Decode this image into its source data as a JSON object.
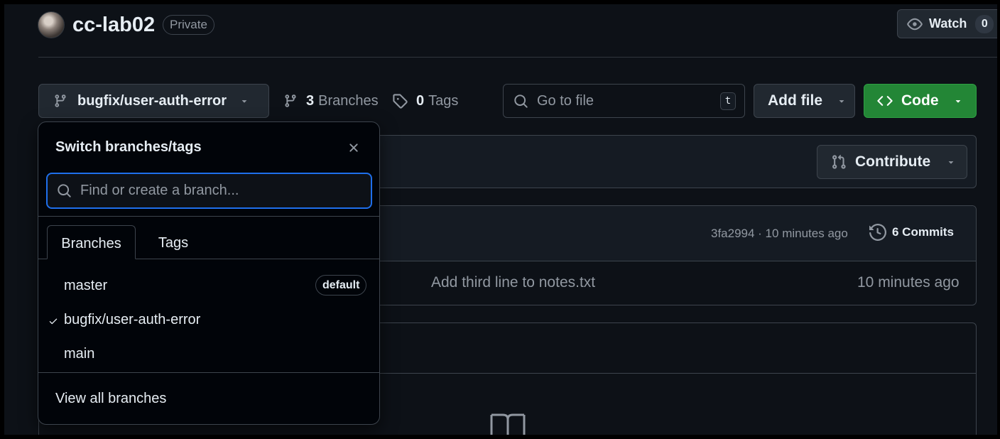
{
  "repo": {
    "name": "cc-lab02",
    "visibility": "Private",
    "watch_label": "Watch",
    "watch_count": "0"
  },
  "toolbar": {
    "current_branch": "bugfix/user-auth-error",
    "branches_count": "3",
    "branches_label": "Branches",
    "tags_count": "0",
    "tags_label": "Tags",
    "goto_placeholder": "Go to file",
    "goto_shortcut": "t",
    "add_file_label": "Add file",
    "code_label": "Code"
  },
  "contribute": {
    "label": "Contribute"
  },
  "latest_commit": {
    "meta": "3fa2994 · 10 minutes ago",
    "commits_label": "6 Commits"
  },
  "file_row": {
    "message": "Add third line to notes.txt",
    "time": "10 minutes ago"
  },
  "branch_dropdown": {
    "title": "Switch branches/tags",
    "search_placeholder": "Find or create a branch...",
    "tabs": [
      "Branches",
      "Tags"
    ],
    "items": [
      {
        "name": "master",
        "badge": "default",
        "selected": false
      },
      {
        "name": "bugfix/user-auth-error",
        "selected": true
      },
      {
        "name": "main",
        "selected": false
      }
    ],
    "view_all": "View all branches"
  },
  "colors": {
    "background": "#0d1117",
    "accent_focus": "#1f6feb",
    "code_button": "#238636",
    "border": "#3d444d"
  }
}
